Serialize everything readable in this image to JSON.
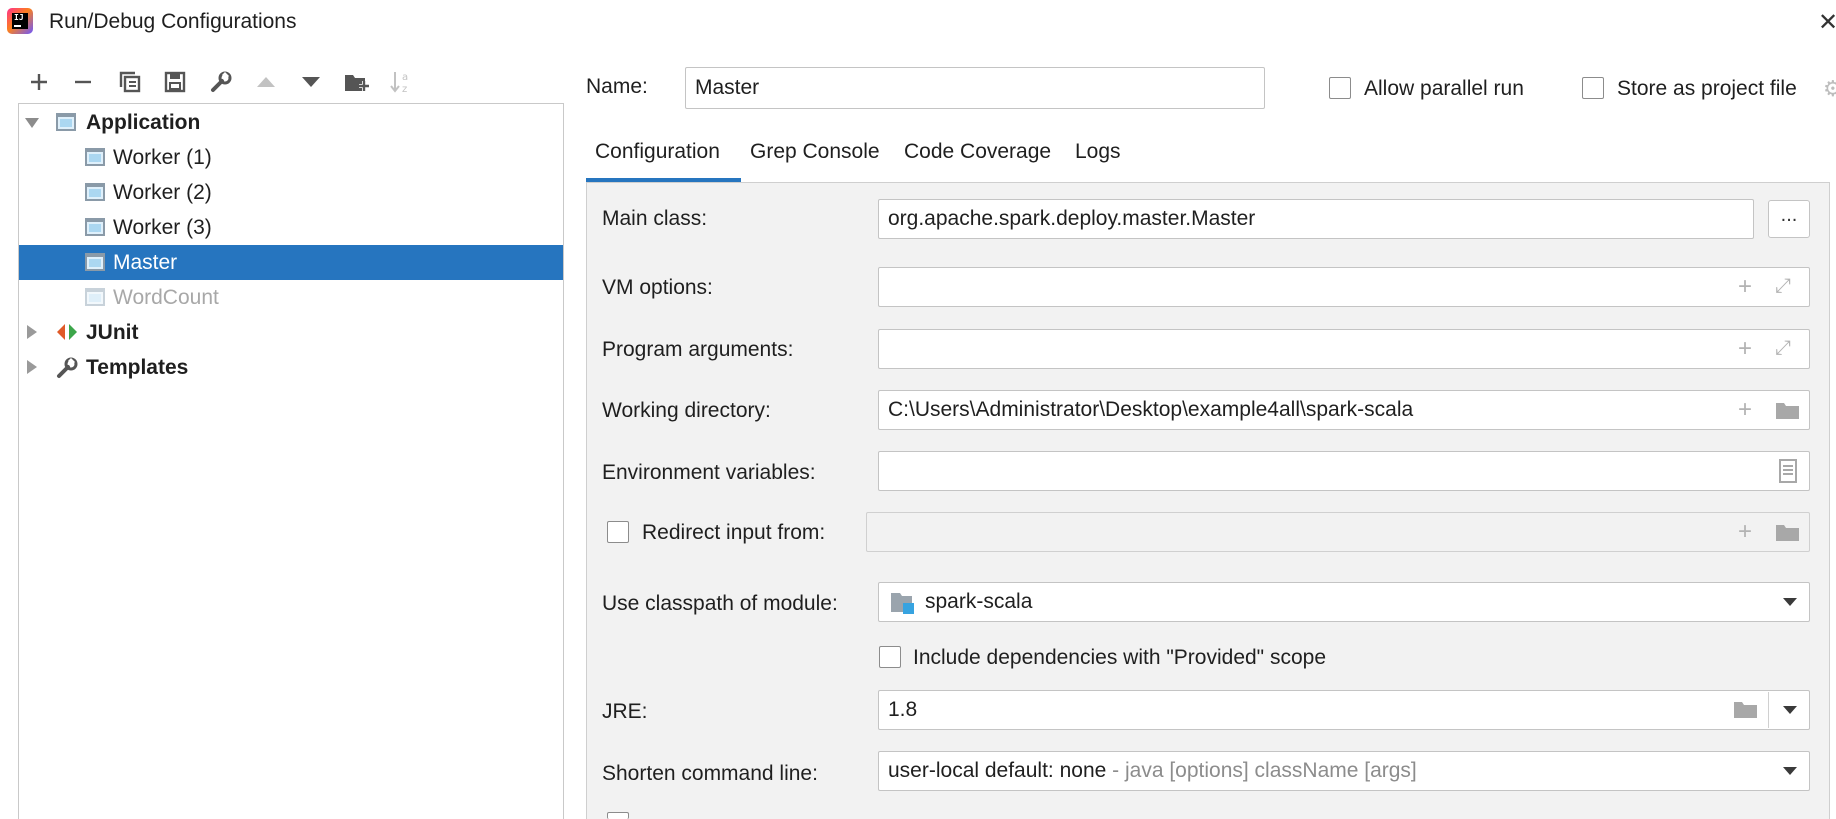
{
  "window": {
    "title": "Run/Debug Configurations"
  },
  "toolbar": {
    "icons": [
      "add-icon",
      "remove-icon",
      "copy-icon",
      "save-icon",
      "wrench-icon",
      "move-up-icon",
      "move-down-icon",
      "new-folder-icon",
      "sort-icon"
    ]
  },
  "tree": {
    "groups": [
      {
        "label": "Application",
        "expanded": true,
        "items": [
          {
            "label": "Worker (1)"
          },
          {
            "label": "Worker (2)"
          },
          {
            "label": "Worker (3)"
          },
          {
            "label": "Master",
            "selected": true
          },
          {
            "label": "WordCount",
            "disabled": true
          }
        ]
      },
      {
        "label": "JUnit",
        "expanded": false
      },
      {
        "label": "Templates",
        "expanded": false
      }
    ]
  },
  "header": {
    "name_label": "Name:",
    "name_value": "Master",
    "allow_parallel_label": "Allow parallel run",
    "store_project_label": "Store as project file"
  },
  "tabs": [
    {
      "label": "Configuration",
      "active": true
    },
    {
      "label": "Grep Console"
    },
    {
      "label": "Code Coverage"
    },
    {
      "label": "Logs"
    }
  ],
  "form": {
    "main_class": {
      "label": "Main class:",
      "value": "org.apache.spark.deploy.master.Master",
      "button": "..."
    },
    "vm_options": {
      "label": "VM options:",
      "value": ""
    },
    "program_arguments": {
      "label": "Program arguments:",
      "value": ""
    },
    "working_directory": {
      "label": "Working directory:",
      "value": "C:\\Users\\Administrator\\Desktop\\example4all\\spark-scala"
    },
    "environment_variables": {
      "label": "Environment variables:",
      "value": ""
    },
    "redirect_input": {
      "label": "Redirect input from:",
      "value": ""
    },
    "classpath_module": {
      "label": "Use classpath of module:",
      "value": "spark-scala"
    },
    "include_provided": {
      "label": "Include dependencies with \"Provided\" scope"
    },
    "jre": {
      "label": "JRE:",
      "value": "1.8"
    },
    "shorten_cmd": {
      "label": "Shorten command line:",
      "value": "user-local default: none",
      "hint": " - java [options] className [args]"
    }
  },
  "colors": {
    "accent": "#2675bf",
    "selection_text": "#ffffff",
    "panel_bg": "#f2f2f2"
  }
}
